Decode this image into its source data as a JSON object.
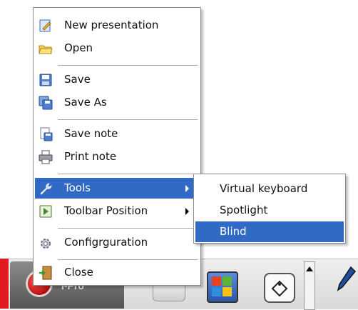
{
  "context_menu": {
    "items": [
      {
        "label": "New presentation",
        "icon": "new-presentation-icon"
      },
      {
        "label": "Open",
        "icon": "open-folder-icon"
      },
      {
        "label": "Save",
        "icon": "save-disk-icon"
      },
      {
        "label": "Save As",
        "icon": "save-as-icon"
      },
      {
        "label": "Save note",
        "icon": "save-note-icon"
      },
      {
        "label": "Print note",
        "icon": "printer-icon"
      },
      {
        "label": "Tools",
        "icon": "wrench-icon",
        "has_submenu": true,
        "highlighted": true
      },
      {
        "label": "Toolbar Position",
        "icon": "toolbar-position-icon",
        "has_submenu": true
      },
      {
        "label": "Configrguration",
        "icon": "gear-icon"
      },
      {
        "label": "Close",
        "icon": "exit-door-icon"
      }
    ]
  },
  "tools_submenu": {
    "items": [
      {
        "label": "Virtual keyboard"
      },
      {
        "label": "Spotlight"
      },
      {
        "label": "Blind",
        "highlighted": true
      }
    ]
  },
  "taskbar": {
    "app_label": "I-Pro",
    "icons": [
      "eraser-icon",
      "windows-logo-icon",
      "paint-bucket-icon",
      "pen-icon"
    ]
  },
  "colors": {
    "highlight": "#316ac5",
    "taskbar_accent": "#e11b22"
  }
}
